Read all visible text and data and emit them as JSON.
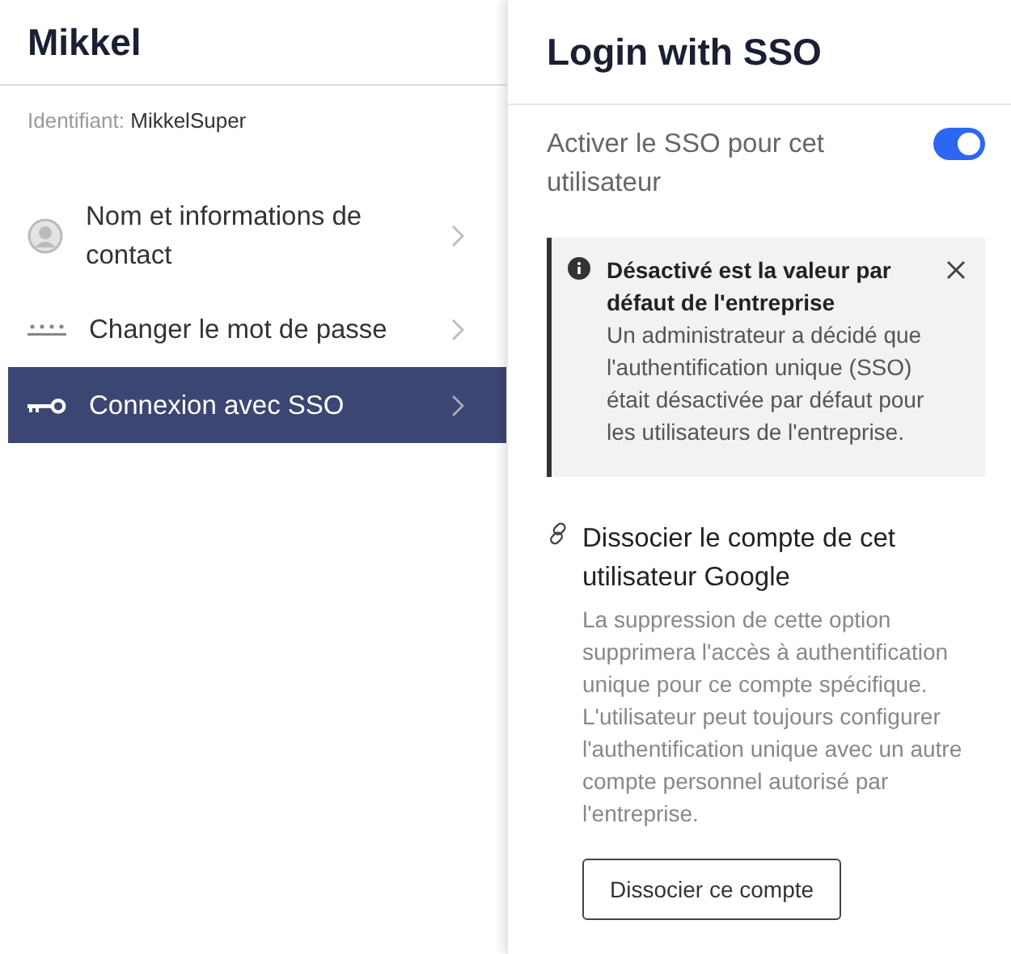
{
  "user": {
    "name": "Mikkel",
    "id_label": "Identifiant:",
    "id_value": "MikkelSuper"
  },
  "menu": [
    {
      "kind": "person",
      "label": "Nom et informations de contact",
      "selected": false
    },
    {
      "kind": "password",
      "label": "Changer le mot de passe",
      "selected": false
    },
    {
      "kind": "key",
      "label": "Connexion avec SSO",
      "selected": true
    }
  ],
  "panel": {
    "title": "Login with SSO",
    "toggle_label": "Activer le SSO pour cet utilisateur",
    "toggle_on": true,
    "notice": {
      "title": "Désactivé est la valeur par défaut de l'entreprise",
      "body": "Un administrateur a décidé que l'authentification unique (SSO) était désactivée par défaut pour les utilisateurs de l'entreprise."
    },
    "unlink": {
      "title": "Dissocier le compte de cet utilisateur Google",
      "body": "La suppression de cette option supprimera l'accès à authentification unique pour ce compte spécifique. L'utilisateur peut toujours configurer l'authentification unique avec un autre compte personnel autorisé par l'entreprise.",
      "button": "Dissocier ce compte"
    }
  }
}
